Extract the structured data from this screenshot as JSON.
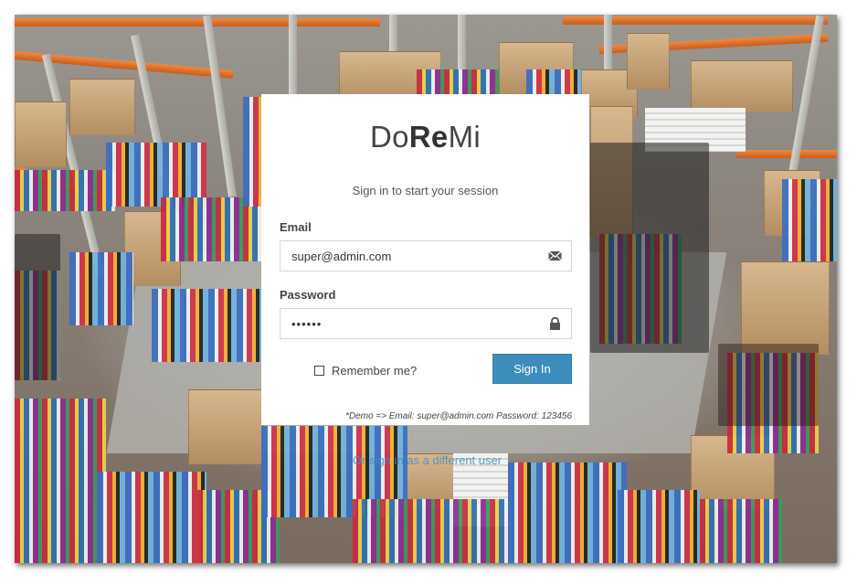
{
  "brand": {
    "logo_pre": "Do",
    "logo_bold": "Re",
    "logo_post": "Mi"
  },
  "login": {
    "subtitle": "Sign in to start your session",
    "email_label": "Email",
    "email_value": "super@admin.com",
    "email_icon": "envelope-icon",
    "password_label": "Password",
    "password_value": "••••••",
    "password_icon": "lock-icon",
    "remember_label": "Remember me?",
    "remember_checked": false,
    "submit_label": "Sign In",
    "demo_note": "*Demo => Email: super@admin.com Password: 123456",
    "different_user_link": "Or sign in as a different user"
  },
  "colors": {
    "primary": "#3c8dbc",
    "link": "#4a8fc2",
    "input_border": "#d2d6de"
  }
}
